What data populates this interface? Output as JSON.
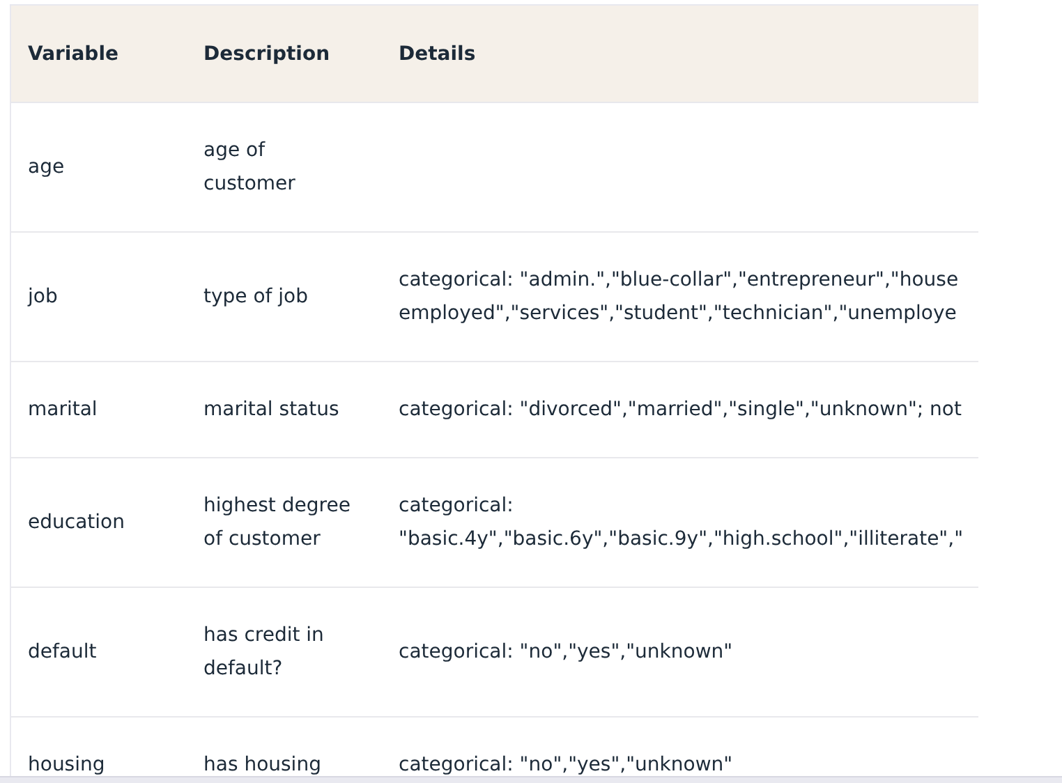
{
  "table": {
    "columns": [
      "Variable",
      "Description",
      "Details"
    ],
    "rows": [
      {
        "variable": "age",
        "description": [
          "age of",
          "customer"
        ],
        "details": []
      },
      {
        "variable": "job",
        "description": [
          "type of job"
        ],
        "details": [
          "categorical: \"admin.\",\"blue-collar\",\"entrepreneur\",\"house",
          "employed\",\"services\",\"student\",\"technician\",\"unemploye"
        ]
      },
      {
        "variable": "marital",
        "description": [
          "marital status"
        ],
        "details": [
          "categorical: \"divorced\",\"married\",\"single\",\"unknown\"; not"
        ]
      },
      {
        "variable": "education",
        "description": [
          "highest degree",
          "of customer"
        ],
        "details": [
          "categorical:",
          "\"basic.4y\",\"basic.6y\",\"basic.9y\",\"high.school\",\"illiterate\",\""
        ]
      },
      {
        "variable": "default",
        "description": [
          "has credit in",
          "default?"
        ],
        "details": [
          "categorical: \"no\",\"yes\",\"unknown\""
        ]
      },
      {
        "variable": "housing",
        "description": [
          "has housing"
        ],
        "details": [
          "categorical: \"no\",\"yes\",\"unknown\""
        ]
      }
    ]
  }
}
